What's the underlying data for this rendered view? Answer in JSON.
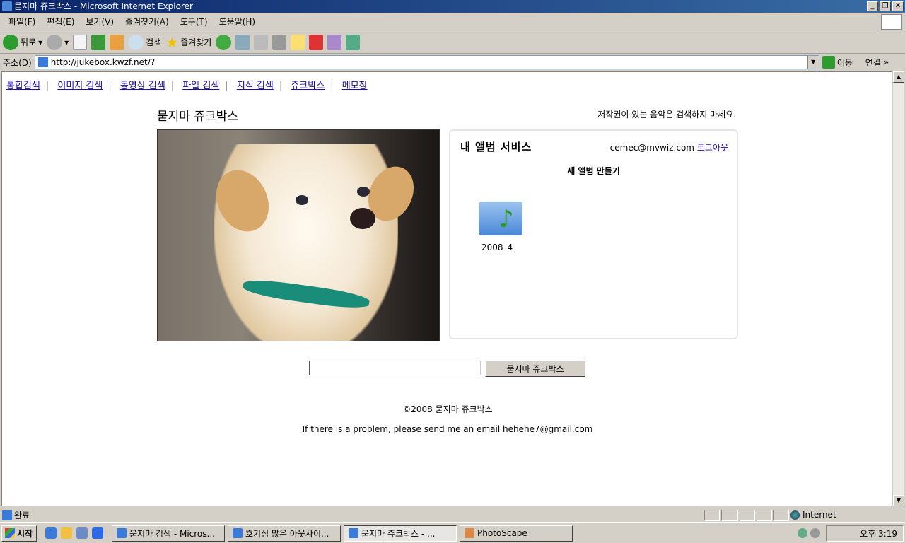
{
  "window": {
    "title": "묻지마 쥬크박스 - Microsoft Internet Explorer"
  },
  "menu": [
    "파일(F)",
    "편집(E)",
    "보기(V)",
    "즐겨찾기(A)",
    "도구(T)",
    "도움말(H)"
  ],
  "toolbar": {
    "back": "뒤로",
    "search": "검색",
    "favorites": "즐겨찾기"
  },
  "address": {
    "label": "주소(D)",
    "url": "http://jukebox.kwzf.net/?",
    "go": "이동",
    "links": "연결"
  },
  "nav": [
    "통합검색",
    "이미지 검색",
    "동영상 검색",
    "파일 검색",
    "지식 검색",
    "쥬크박스",
    "메모장"
  ],
  "page": {
    "title": "묻지마 쥬크박스",
    "notice": "저작권이 있는 음악은 검색하지 마세요.",
    "album": {
      "heading": "내 앨범 서비스",
      "email": "cemec@mvwiz.com",
      "logout": "로그아웃",
      "new_album": "새 앨범 만들기",
      "folders": [
        {
          "name": "2008_4",
          "icon": "music-folder-icon"
        }
      ]
    },
    "search": {
      "value": "",
      "button": "묻지마 쥬크박스"
    },
    "copyright": "©2008 묻지마 쥬크박스",
    "contact": "If there is a problem, please send me an email hehehe7@gmail.com"
  },
  "status": {
    "text": "완료",
    "zone": "Internet"
  },
  "taskbar": {
    "start": "시작",
    "tasks": [
      "묻지마 검색 - Micros...",
      "호기심 많은 아웃사이...",
      "묻지마 쥬크박스 - ...",
      "PhotoScape"
    ],
    "active_index": 2,
    "clock": "오후 3:19"
  }
}
